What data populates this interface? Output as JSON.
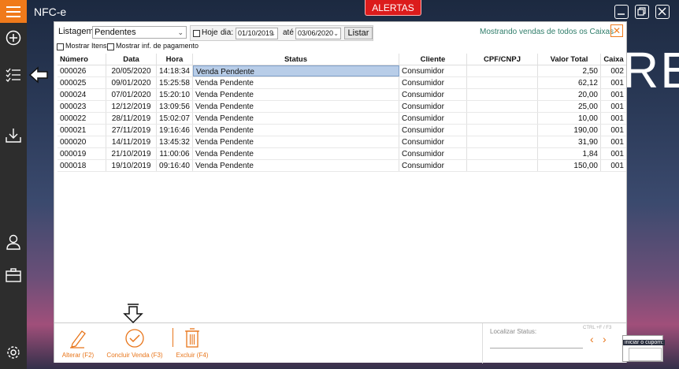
{
  "app": {
    "title": "NFC-e",
    "alert_label": "ALERTAS",
    "background_text": "RE"
  },
  "filters": {
    "listagem_label": "Listagem",
    "listagem_value": "Pendentes",
    "hoje_label": "Hoje",
    "dia_label": "dia:",
    "date_from": "01/10/2019",
    "ate_label": "até",
    "date_to": "03/06/2020",
    "listar_label": "Listar",
    "mostrar_itens_label": "Mostrar Itens",
    "mostrar_pagamento_label": "Mostrar inf. de pagamento",
    "showing_text": "Mostrando vendas de todos os Caixas"
  },
  "table": {
    "headers": [
      "Número",
      "Data",
      "Hora",
      "Status",
      "Cliente",
      "CPF/CNPJ",
      "Valor Total",
      "Caixa"
    ],
    "rows": [
      [
        "000026",
        "20/05/2020",
        "14:18:34",
        "Venda Pendente",
        "Consumidor",
        "",
        "2,50",
        "002"
      ],
      [
        "000025",
        "09/01/2020",
        "15:25:58",
        "Venda Pendente",
        "Consumidor",
        "",
        "62,12",
        "001"
      ],
      [
        "000024",
        "07/01/2020",
        "15:20:10",
        "Venda Pendente",
        "Consumidor",
        "",
        "20,00",
        "001"
      ],
      [
        "000023",
        "12/12/2019",
        "13:09:56",
        "Venda Pendente",
        "Consumidor",
        "",
        "25,00",
        "001"
      ],
      [
        "000022",
        "28/11/2019",
        "15:02:07",
        "Venda Pendente",
        "Consumidor",
        "",
        "10,00",
        "001"
      ],
      [
        "000021",
        "27/11/2019",
        "19:16:46",
        "Venda Pendente",
        "Consumidor",
        "",
        "190,00",
        "001"
      ],
      [
        "000020",
        "14/11/2019",
        "13:45:32",
        "Venda Pendente",
        "Consumidor",
        "",
        "31,90",
        "001"
      ],
      [
        "000019",
        "21/10/2019",
        "11:00:06",
        "Venda Pendente",
        "Consumidor",
        "",
        "1,84",
        "001"
      ],
      [
        "000018",
        "19/10/2019",
        "09:16:40",
        "Venda Pendente",
        "Consumidor",
        "",
        "150,00",
        "001"
      ]
    ]
  },
  "actions": {
    "alterar_label": "Alterar (F2)",
    "concluir_label": "Concluir Venda (F3)",
    "excluir_label": "Excluir (F4)"
  },
  "search": {
    "label": "Localizar Status:",
    "hint": "CTRL +F / F3",
    "value": ""
  },
  "coupon": {
    "label": "iniciar o cupom:"
  },
  "colors": {
    "accent": "#f07a1a",
    "alert": "#dc1c1c",
    "sidebar": "#2d2d2d",
    "selected": "#b8cde8"
  }
}
